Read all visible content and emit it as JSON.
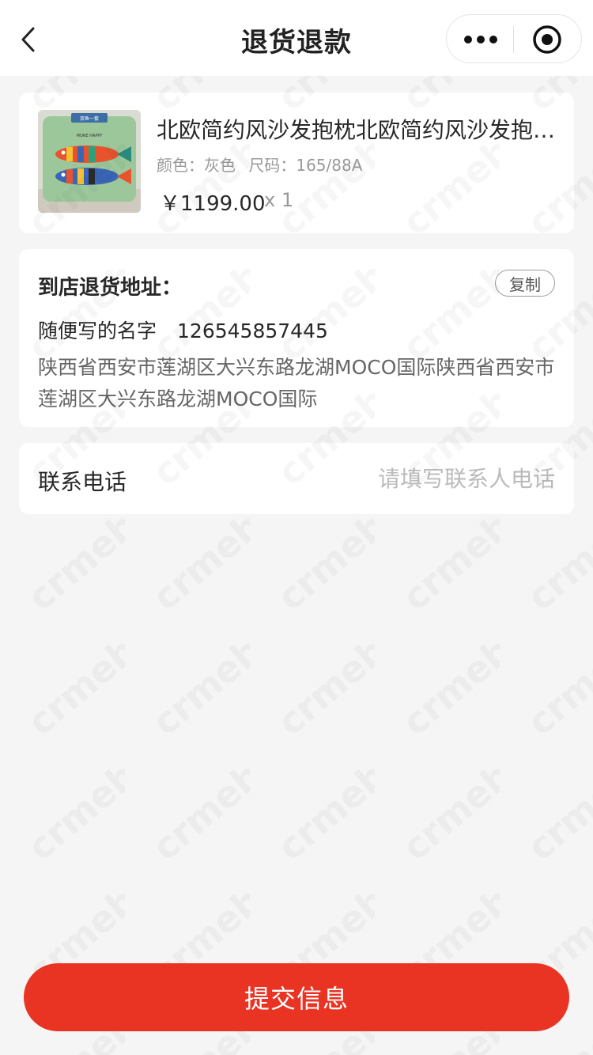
{
  "navbar": {
    "title": "退货退款",
    "back_icon": "chevron-left-icon",
    "more_icon": "more-dots-icon",
    "close_icon": "target-circle-icon"
  },
  "product": {
    "name": "北欧简约风沙发抱枕北欧简约风沙发抱枕北欧简约风沙发抱枕",
    "spec_color_label": "颜色：",
    "spec_color": "灰色",
    "spec_size_label": "尺码：",
    "spec_size": "165/88A",
    "price": "￥1199.00",
    "quantity": "x 1",
    "image_tag": "双鱼一套",
    "image_caption": "MORE HAPPY"
  },
  "address": {
    "title": "到店退货地址：",
    "copy_label": "复制",
    "name": "随便写的名字",
    "phone": "126545857445",
    "detail": "陕西省西安市莲湖区大兴东路龙湖MOCO国际陕西省西安市莲湖区大兴东路龙湖MOCO国际"
  },
  "contact": {
    "label": "联系电话",
    "value": "",
    "placeholder": "请填写联系人电话"
  },
  "submit": {
    "label": "提交信息"
  },
  "watermark": {
    "text": "crmeb"
  },
  "colors": {
    "accent": "#e93323",
    "background": "#f5f5f5",
    "card": "#ffffff",
    "text_primary": "#282828",
    "text_secondary": "#999999",
    "placeholder": "#bbbbbb"
  }
}
